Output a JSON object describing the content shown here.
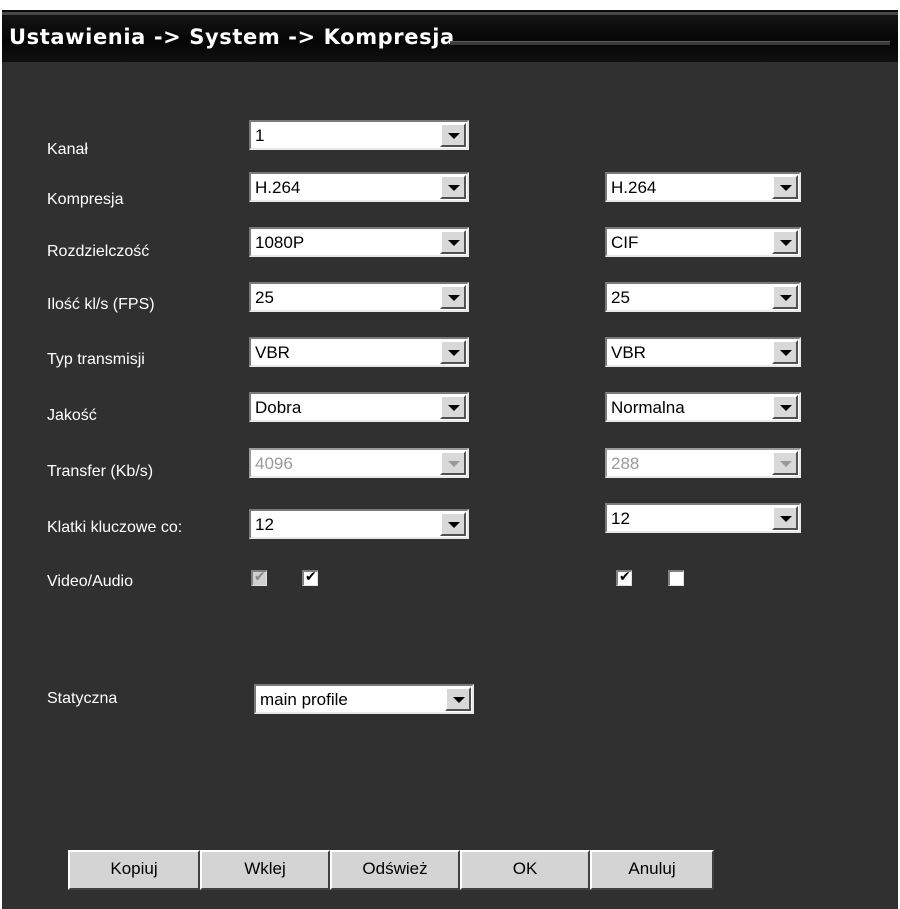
{
  "title": "Ustawienia -> System -> Kompresja",
  "rows": [
    {
      "label": "Kanał",
      "main": "1",
      "extra": null
    },
    {
      "label": "Kompresja",
      "main": "H.264",
      "extra": "H.264"
    },
    {
      "label": "Rozdzielczość",
      "main": "1080P",
      "extra": "CIF"
    },
    {
      "label": "Ilość kl/s (FPS)",
      "main": "25",
      "extra": "25"
    },
    {
      "label": "Typ transmisji",
      "main": "VBR",
      "extra": "VBR"
    },
    {
      "label": "Jakość",
      "main": "Dobra",
      "extra": "Normalna"
    },
    {
      "label": "Transfer (Kb/s)",
      "main": "4096",
      "extra": "288"
    },
    {
      "label": "Klatki kluczowe co:",
      "main": "12",
      "extra": "12"
    }
  ],
  "video_audio": {
    "label": "Video/Audio",
    "main_video": true,
    "main_audio": true,
    "extra_video": true,
    "extra_audio": false
  },
  "static": {
    "label": "Statyczna",
    "value": "main profile"
  },
  "buttons": {
    "copy": "Kopiuj",
    "paste": "Wklej",
    "refresh": "Odśwież",
    "ok": "OK",
    "cancel": "Anuluj"
  },
  "check_glyph": "✔"
}
